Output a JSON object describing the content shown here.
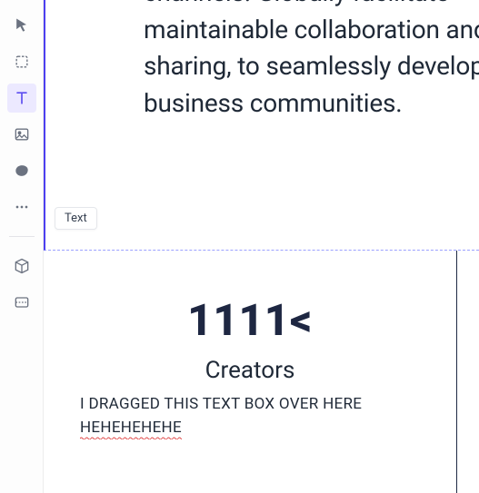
{
  "toolbar": {
    "tools": [
      {
        "name": "select-tool",
        "icon": "cursor"
      },
      {
        "name": "frame-tool",
        "icon": "frame"
      },
      {
        "name": "text-tool",
        "icon": "text",
        "active": true
      },
      {
        "name": "image-tool",
        "icon": "image"
      },
      {
        "name": "shape-tool",
        "icon": "blob"
      },
      {
        "name": "more-tool",
        "icon": "dots"
      }
    ],
    "secondary": [
      {
        "name": "package-tool",
        "icon": "cube"
      },
      {
        "name": "theme-tool",
        "icon": "swatch"
      }
    ]
  },
  "text_chip": {
    "label": "Text"
  },
  "top_block": {
    "paragraph": "channels. Globally facilitate maintainable collaboration and sharing, to seamlessly develop business communities."
  },
  "bottom_card": {
    "big_number": "1111<",
    "subtitle": "Creators",
    "dragged_line": "I DRAGGED THIS TEXT BOX OVER HERE",
    "hehe_line": "HEHEHEHEHE"
  },
  "colors": {
    "accent": "#5b4df0",
    "selection_border": "#4c3ff0",
    "heading_dark": "#1e2742"
  }
}
